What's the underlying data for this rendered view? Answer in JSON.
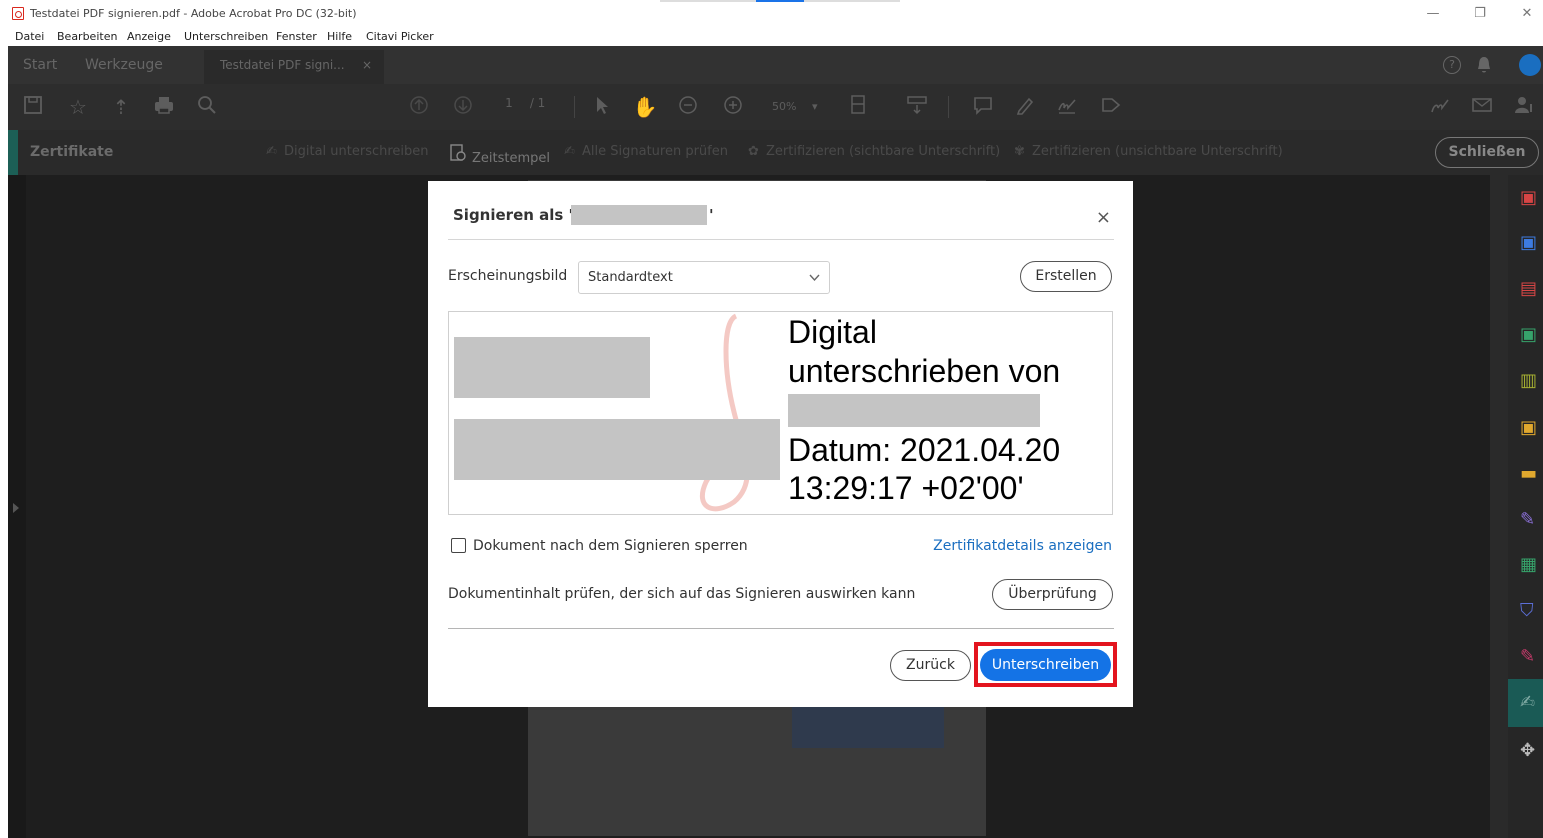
{
  "window": {
    "title": "Testdatei PDF signieren.pdf - Adobe Acrobat Pro DC (32-bit)",
    "controls": {
      "minimize": "—",
      "restore": "❐",
      "close": "✕"
    }
  },
  "menu": [
    "Datei",
    "Bearbeiten",
    "Anzeige",
    "Unterschreiben",
    "Fenster",
    "Hilfe",
    "Citavi Picker"
  ],
  "tabs": {
    "home": "Start",
    "tools": "Werkzeuge",
    "document": "Testdatei PDF signi...",
    "document_close": "×",
    "help": "?"
  },
  "toolbar": {
    "page_current": "1",
    "page_total": "/ 1",
    "zoom": "50%",
    "zoom_chevron": "▾"
  },
  "subtoolbar": {
    "label": "Zertifikate",
    "items": [
      {
        "label": "Digital unterschreiben",
        "icon": "pen-sign-icon"
      },
      {
        "label": "Zeitstempel",
        "icon": "timestamp-icon"
      },
      {
        "label": "Alle Signaturen prüfen",
        "icon": "verify-signatures-icon"
      },
      {
        "label": "Zertifizieren (sichtbare Unterschrift)",
        "icon": "certify-visible-icon"
      },
      {
        "label": "Zertifizieren (unsichtbare Unterschrift)",
        "icon": "certify-invisible-icon"
      }
    ],
    "close_label": "Schließen"
  },
  "dialog": {
    "title_prefix": "Signieren als \"",
    "title_suffix": "'",
    "close": "×",
    "appearance_label": "Erscheinungsbild",
    "appearance_value": "Standardtext",
    "create_label": "Erstellen",
    "preview": {
      "line1": "Digital",
      "line2": "unterschrieben von",
      "line3": "Datum: 2021.04.20",
      "line4": "13:29:17 +02'00'"
    },
    "lock_label": "Dokument nach dem Signieren sperren",
    "details_link": "Zertifikatdetails anzeigen",
    "review_text": "Dokumentinhalt prüfen, der sich auf das Signieren auswirken kann",
    "review_button": "Überprüfung",
    "back_button": "Zurück",
    "sign_button": "Unterschreiben"
  },
  "colors": {
    "accent_blue": "#1473e6",
    "highlight_red": "#e3141e",
    "acrobat_red": "#d9281e",
    "panel_teal": "#1c5f56"
  }
}
